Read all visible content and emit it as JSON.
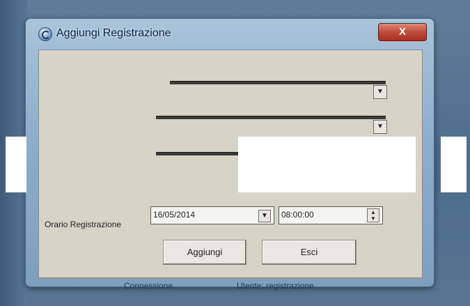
{
  "window": {
    "title": "Aggiungi Registrazione",
    "close_label": "X"
  },
  "form": {
    "orario_label": "Orario Registrazione",
    "date_value": "16/05/2014",
    "time_value": "08:00:00"
  },
  "buttons": {
    "add_label": "Aggiungi",
    "exit_label": "Esci"
  },
  "taskbar": {
    "left_text": "Connessione",
    "right_text": "Utente: registrazione"
  },
  "colors": {
    "close_button": "#c24a3a",
    "dialog_bg": "#d7d3c6",
    "title_bar": "#8fb0cc"
  }
}
